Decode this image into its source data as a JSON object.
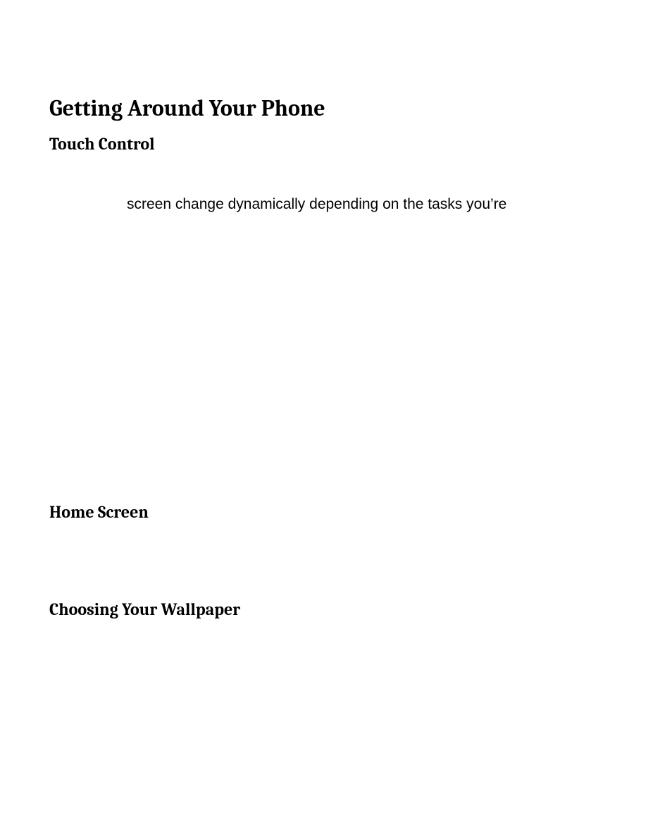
{
  "title": "Getting Around Your Phone",
  "sections": {
    "touch_control": {
      "heading": "Touch Control",
      "body": "screen change dynamically depending on the tasks you’re"
    },
    "home_screen": {
      "heading": "Home Screen"
    },
    "choosing_wallpaper": {
      "heading": "Choosing Your Wallpaper"
    }
  }
}
